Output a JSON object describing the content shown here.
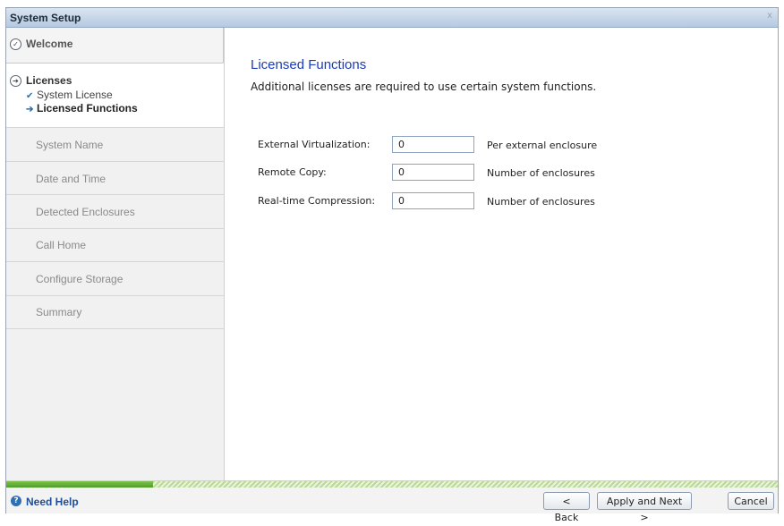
{
  "window": {
    "title": "System Setup",
    "close_glyph": "x"
  },
  "sidebar": {
    "welcome": {
      "label": "Welcome",
      "icon": "check-circle-icon"
    },
    "licenses": {
      "label": "Licenses",
      "icon": "arrow-circle-icon",
      "substeps": [
        {
          "label": "System License",
          "mark": "✔",
          "icon": "check-icon"
        },
        {
          "label": "Licensed Functions",
          "mark": "➔",
          "icon": "arrow-right-icon"
        }
      ]
    },
    "steps": [
      "System Name",
      "Date and Time",
      "Detected Enclosures",
      "Call Home",
      "Configure Storage",
      "Summary"
    ]
  },
  "content": {
    "heading": "Licensed Functions",
    "description": "Additional licenses are required to use certain system functions.",
    "fields": [
      {
        "label": "External Virtualization:",
        "value": "0",
        "unit": "Per external enclosure"
      },
      {
        "label": "Remote Copy:",
        "value": "0",
        "unit": "Number of enclosures"
      },
      {
        "label": "Real-time Compression:",
        "value": "0",
        "unit": "Number of enclosures"
      }
    ]
  },
  "progress": {
    "fraction": 0.19,
    "colors": {
      "fill": "#5aa832",
      "track": "#d6ebc2"
    }
  },
  "footer": {
    "help_label": "Need Help",
    "back_label": "< Back",
    "apply_label": "Apply and Next >",
    "cancel_label": "Cancel"
  }
}
